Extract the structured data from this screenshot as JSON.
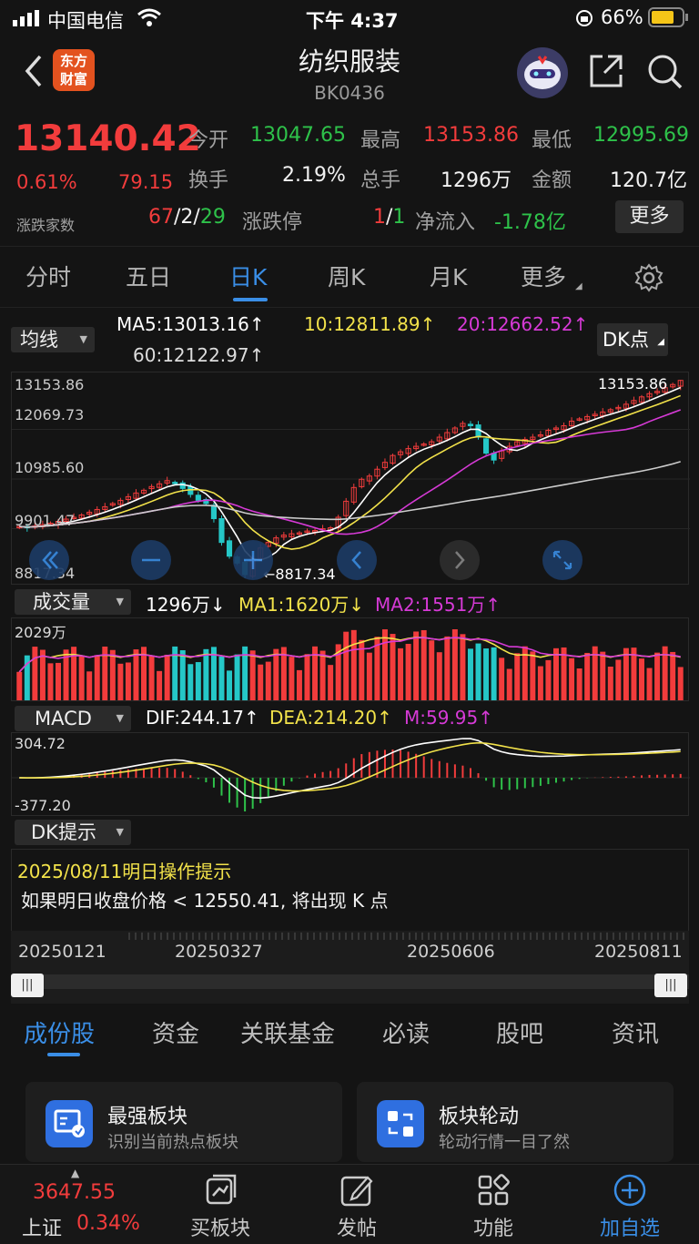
{
  "status_bar": {
    "carrier": "中国电信",
    "time": "下午 4:37",
    "battery": "66%"
  },
  "header": {
    "title": "纺织服装",
    "code": "BK0436",
    "logo_text_top": "东方",
    "logo_text_bottom": "财富"
  },
  "quote": {
    "price": "13140.42",
    "pct": "0.61%",
    "change": "79.15",
    "open_label": "今开",
    "open": "13047.65",
    "high_label": "最高",
    "high": "13153.86",
    "low_label": "最低",
    "low": "12995.69",
    "turnover_label": "换手",
    "turnover": "2.19%",
    "volume_label": "总手",
    "volume": "1296万",
    "amount_label": "金额",
    "amount": "120.7亿",
    "updown_label": "涨跌家数",
    "up": "67",
    "flat": "2",
    "down": "29",
    "limit_label": "涨跌停",
    "limit_up": "1",
    "limit_down": "1",
    "netflow_label": "净流入",
    "netflow": "-1.78亿",
    "more_button": "更多"
  },
  "tabs": [
    "分时",
    "五日",
    "日K",
    "周K",
    "月K",
    "更多"
  ],
  "ma": {
    "selector": "均线",
    "ma5": "MA5:13013.16↑",
    "ma10": "10:12811.89↑",
    "ma20": "20:12662.52↑",
    "ma60": "60:12122.97↑",
    "dk_button": "DK点"
  },
  "kline": {
    "y_top": "13153.86",
    "y_2": "12069.73",
    "y_3": "10985.60",
    "y_4": "9901.47",
    "y_bottom": "8817.34",
    "high_marker": "13153.86",
    "low_marker": "←8817.34"
  },
  "volume": {
    "selector": "成交量",
    "vol": "1296万↓",
    "ma1": "MA1:1620万↓",
    "ma2": "MA2:1551万↑",
    "y_top": "2029万"
  },
  "macd": {
    "selector": "MACD",
    "dif": "DIF:244.17↑",
    "dea": "DEA:214.20↑",
    "m": "M:59.95↑",
    "y_top": "304.72",
    "y_bottom": "-377.20"
  },
  "dk": {
    "selector": "DK提示",
    "date_line": "2025/08/11明日操作提示",
    "message": "如果明日收盘价格 < 12550.41, 将出现 K 点"
  },
  "x_axis": [
    "20250121",
    "20250327",
    "20250606",
    "20250811"
  ],
  "bottom_tabs": [
    "成份股",
    "资金",
    "关联基金",
    "必读",
    "股吧",
    "资讯"
  ],
  "cards": [
    {
      "title": "最强板块",
      "subtitle": "识别当前热点板块"
    },
    {
      "title": "板块轮动",
      "subtitle": "轮动行情一目了然"
    }
  ],
  "nav": {
    "index_value": "3647.55",
    "index_name": "上证",
    "index_pct": "0.34%",
    "items": [
      "买板块",
      "发帖",
      "功能",
      "加自选"
    ]
  },
  "colors": {
    "up": "#f23c3c",
    "down": "#2ec24a",
    "accent": "#3a8ee6",
    "ma5": "#ffffff",
    "ma10": "#f2e24a",
    "ma20": "#d63ad6",
    "ma60": "#cccccc"
  },
  "chart_data": {
    "type": "candlestick",
    "ylim": [
      8817.34,
      13153.86
    ],
    "x_ticks": [
      "20250121",
      "20250327",
      "20250606",
      "20250811"
    ],
    "close": [
      9950,
      9920,
      9960,
      9990,
      10020,
      10060,
      10110,
      10150,
      10200,
      10260,
      10320,
      10380,
      10450,
      10520,
      10600,
      10680,
      10740,
      10820,
      10880,
      10950,
      10900,
      10780,
      10650,
      10520,
      10450,
      10120,
      9600,
      9300,
      9150,
      8900,
      9250,
      9480,
      9600,
      9700,
      9760,
      9790,
      9810,
      9850,
      9860,
      9900,
      9920,
      10150,
      10500,
      10800,
      10980,
      11050,
      11200,
      11350,
      11500,
      11580,
      11650,
      11700,
      11750,
      11800,
      11900,
      12000,
      12100,
      12200,
      12150,
      11900,
      11550,
      11400,
      11600,
      11700,
      11800,
      11850,
      11900,
      11950,
      12050,
      12100,
      12150,
      12250,
      12300,
      12350,
      12400,
      12450,
      12500,
      12550,
      12620,
      12700,
      12780,
      12850,
      12900,
      12980,
      13050,
      13140
    ]
  }
}
